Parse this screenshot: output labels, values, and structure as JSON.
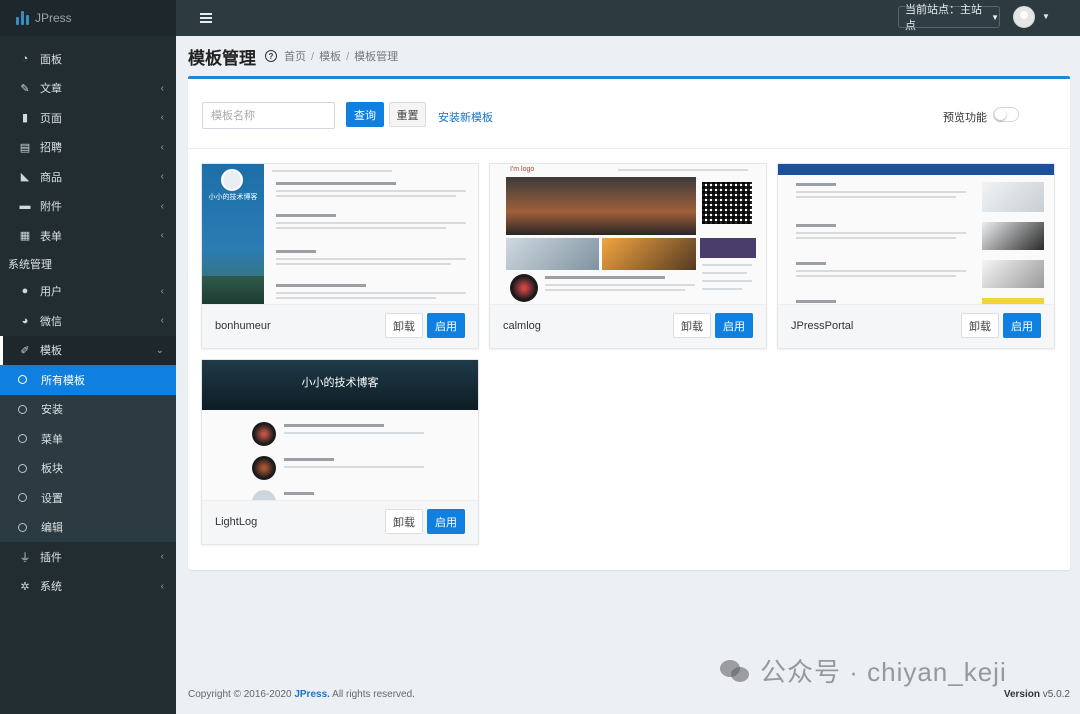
{
  "brand": {
    "name": "JPress"
  },
  "sidebar": {
    "items": [
      {
        "label": "面板",
        "icon": "dashboard-icon",
        "glyph": "◔",
        "chevron": false
      },
      {
        "label": "文章",
        "icon": "edit-icon",
        "glyph": "✎",
        "chevron": true
      },
      {
        "label": "页面",
        "icon": "file-icon",
        "glyph": "▮",
        "chevron": true
      },
      {
        "label": "招聘",
        "icon": "briefcase-icon",
        "glyph": "▤",
        "chevron": true
      },
      {
        "label": "商品",
        "icon": "goods-icon",
        "glyph": "◣",
        "chevron": true
      },
      {
        "label": "附件",
        "icon": "folder-icon",
        "glyph": "▬",
        "chevron": true
      },
      {
        "label": "表单",
        "icon": "table-icon",
        "glyph": "▦",
        "chevron": true
      }
    ],
    "section_label": "系统管理",
    "system_items": [
      {
        "label": "用户",
        "icon": "user-icon",
        "glyph": "●",
        "chevron": true
      },
      {
        "label": "微信",
        "icon": "wechat-icon",
        "glyph": "◕",
        "chevron": true
      }
    ],
    "template_menu": {
      "label": "模板",
      "icon": "brush-icon",
      "glyph": "✐"
    },
    "template_sub": [
      "所有模板",
      "安装",
      "菜单",
      "板块",
      "设置",
      "编辑"
    ],
    "bottom_items": [
      {
        "label": "插件",
        "icon": "plug-icon",
        "glyph": "⏚",
        "chevron": true
      },
      {
        "label": "系统",
        "icon": "cog-icon",
        "glyph": "✲",
        "chevron": true
      }
    ]
  },
  "topbar": {
    "site_select": "当前站点：主站点"
  },
  "page": {
    "title": "模板管理",
    "breadcrumb": [
      "首页",
      "模板",
      "模板管理"
    ]
  },
  "toolbar": {
    "search_placeholder": "模板名称",
    "query_label": "查询",
    "reset_label": "重置",
    "install_link": "安装新模板",
    "preview_label": "预览功能"
  },
  "templates": [
    {
      "name": "bonhumeur",
      "uninstall": "卸载",
      "enable": "启用",
      "blog_title": "小小的技术博客"
    },
    {
      "name": "calmlog",
      "uninstall": "卸载",
      "enable": "启用",
      "logo": "I'm logo"
    },
    {
      "name": "JPressPortal",
      "uninstall": "卸载",
      "enable": "启用"
    },
    {
      "name": "LightLog",
      "uninstall": "卸载",
      "enable": "启用",
      "blog_title": "小小的技术博客"
    }
  ],
  "footer": {
    "copyright_prefix": "Copyright © 2016-2020 ",
    "brand": "JPress.",
    "copyright_suffix": " All rights reserved.",
    "version_label": "Version",
    "version": "v5.0.2"
  },
  "watermark": "公众号 · chiyan_keji",
  "colors": {
    "primary": "#0f7fe0",
    "sidebar": "#222d32",
    "topbar": "#2d3a40",
    "box_border": "#1f87d0"
  }
}
